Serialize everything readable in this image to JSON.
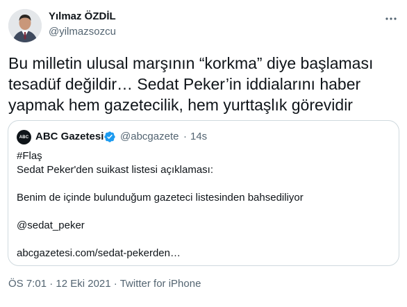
{
  "author": {
    "name": "Yılmaz ÖZDİL",
    "handle": "@yilmazsozcu"
  },
  "tweet": {
    "text": "Bu milletin ulusal marşının “korkma” diye başlaması\ntesadüf değildir… Sedat Peker’in iddialarını haber\nyapmak hem gazetecilik, hem yurttaşlık görevidir"
  },
  "quoted": {
    "avatar_text": "ABC",
    "name": "ABC Gazetesi",
    "handle": "@abcgazete",
    "separator": "·",
    "time": "14s",
    "lines": {
      "l1": "#Flaş",
      "l2": "Sedat Peker'den suikast listesi açıklaması:",
      "l3": "Benim de içinde bulunduğum gazeteci listesinden bahsediliyor",
      "l4": "@sedat_peker",
      "l5": "abcgazetesi.com/sedat-pekerden…"
    }
  },
  "meta": {
    "time": "ÖS 7:01",
    "separator": "·",
    "date": "12 Eki 2021",
    "source": "Twitter for iPhone"
  },
  "icons": {
    "more": "more-horizontal-icon",
    "verified": "verified-badge-icon"
  },
  "colors": {
    "text": "#0f1419",
    "secondary": "#536471",
    "verified": "#1d9bf0",
    "border": "#cfd9de"
  }
}
